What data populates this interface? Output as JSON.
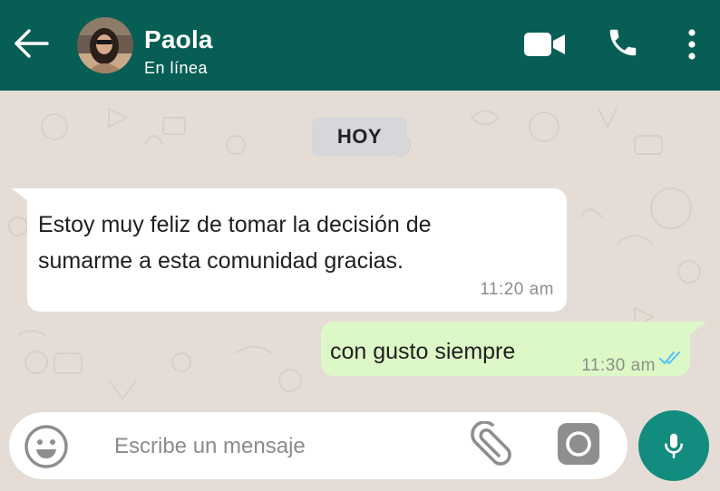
{
  "header": {
    "contact_name": "Paola",
    "status": "En línea",
    "icons": [
      "back-arrow-icon",
      "video-call-icon",
      "phone-call-icon",
      "more-menu-icon"
    ]
  },
  "chat": {
    "date_chip": "HOY",
    "messages": [
      {
        "direction": "incoming",
        "text_line1": "Estoy muy feliz de tomar la decisión de",
        "text_line2": "sumarme a esta comunidad gracias.",
        "time": "11:20 am"
      },
      {
        "direction": "outgoing",
        "text": "con gusto siempre",
        "time": "11:30 am",
        "read_status": "read"
      }
    ]
  },
  "composer": {
    "placeholder": "Escribe un mensaje",
    "value": "",
    "icons": [
      "emoji-icon",
      "attach-clip-icon",
      "camera-icon",
      "microphone-icon"
    ]
  },
  "colors": {
    "header_bg": "#075e54",
    "chat_bg": "#e5ddd5",
    "outgoing_bubble": "#dcf8c6",
    "incoming_bubble": "#ffffff",
    "read_ticks": "#4fc3f7",
    "mic_button": "#128c7e"
  }
}
